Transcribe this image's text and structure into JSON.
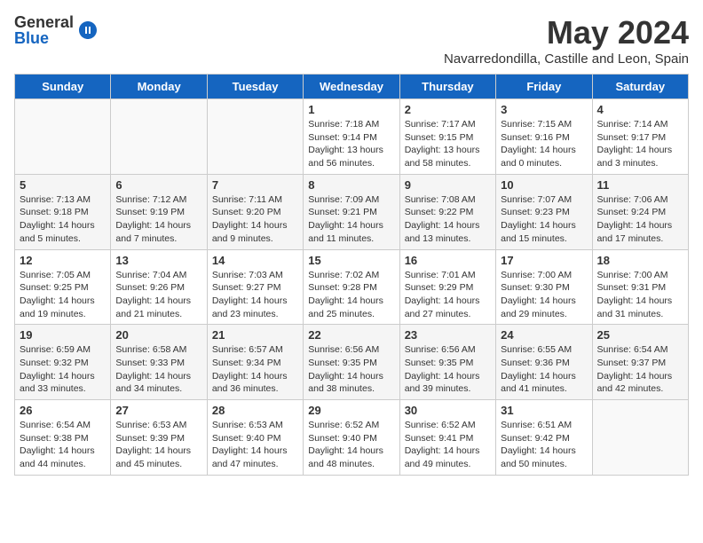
{
  "logo": {
    "general": "General",
    "blue": "Blue"
  },
  "header": {
    "month": "May 2024",
    "location": "Navarredondilla, Castille and Leon, Spain"
  },
  "days_of_week": [
    "Sunday",
    "Monday",
    "Tuesday",
    "Wednesday",
    "Thursday",
    "Friday",
    "Saturday"
  ],
  "weeks": [
    [
      {
        "day": "",
        "info": ""
      },
      {
        "day": "",
        "info": ""
      },
      {
        "day": "",
        "info": ""
      },
      {
        "day": "1",
        "info": "Sunrise: 7:18 AM\nSunset: 9:14 PM\nDaylight: 13 hours\nand 56 minutes."
      },
      {
        "day": "2",
        "info": "Sunrise: 7:17 AM\nSunset: 9:15 PM\nDaylight: 13 hours\nand 58 minutes."
      },
      {
        "day": "3",
        "info": "Sunrise: 7:15 AM\nSunset: 9:16 PM\nDaylight: 14 hours\nand 0 minutes."
      },
      {
        "day": "4",
        "info": "Sunrise: 7:14 AM\nSunset: 9:17 PM\nDaylight: 14 hours\nand 3 minutes."
      }
    ],
    [
      {
        "day": "5",
        "info": "Sunrise: 7:13 AM\nSunset: 9:18 PM\nDaylight: 14 hours\nand 5 minutes."
      },
      {
        "day": "6",
        "info": "Sunrise: 7:12 AM\nSunset: 9:19 PM\nDaylight: 14 hours\nand 7 minutes."
      },
      {
        "day": "7",
        "info": "Sunrise: 7:11 AM\nSunset: 9:20 PM\nDaylight: 14 hours\nand 9 minutes."
      },
      {
        "day": "8",
        "info": "Sunrise: 7:09 AM\nSunset: 9:21 PM\nDaylight: 14 hours\nand 11 minutes."
      },
      {
        "day": "9",
        "info": "Sunrise: 7:08 AM\nSunset: 9:22 PM\nDaylight: 14 hours\nand 13 minutes."
      },
      {
        "day": "10",
        "info": "Sunrise: 7:07 AM\nSunset: 9:23 PM\nDaylight: 14 hours\nand 15 minutes."
      },
      {
        "day": "11",
        "info": "Sunrise: 7:06 AM\nSunset: 9:24 PM\nDaylight: 14 hours\nand 17 minutes."
      }
    ],
    [
      {
        "day": "12",
        "info": "Sunrise: 7:05 AM\nSunset: 9:25 PM\nDaylight: 14 hours\nand 19 minutes."
      },
      {
        "day": "13",
        "info": "Sunrise: 7:04 AM\nSunset: 9:26 PM\nDaylight: 14 hours\nand 21 minutes."
      },
      {
        "day": "14",
        "info": "Sunrise: 7:03 AM\nSunset: 9:27 PM\nDaylight: 14 hours\nand 23 minutes."
      },
      {
        "day": "15",
        "info": "Sunrise: 7:02 AM\nSunset: 9:28 PM\nDaylight: 14 hours\nand 25 minutes."
      },
      {
        "day": "16",
        "info": "Sunrise: 7:01 AM\nSunset: 9:29 PM\nDaylight: 14 hours\nand 27 minutes."
      },
      {
        "day": "17",
        "info": "Sunrise: 7:00 AM\nSunset: 9:30 PM\nDaylight: 14 hours\nand 29 minutes."
      },
      {
        "day": "18",
        "info": "Sunrise: 7:00 AM\nSunset: 9:31 PM\nDaylight: 14 hours\nand 31 minutes."
      }
    ],
    [
      {
        "day": "19",
        "info": "Sunrise: 6:59 AM\nSunset: 9:32 PM\nDaylight: 14 hours\nand 33 minutes."
      },
      {
        "day": "20",
        "info": "Sunrise: 6:58 AM\nSunset: 9:33 PM\nDaylight: 14 hours\nand 34 minutes."
      },
      {
        "day": "21",
        "info": "Sunrise: 6:57 AM\nSunset: 9:34 PM\nDaylight: 14 hours\nand 36 minutes."
      },
      {
        "day": "22",
        "info": "Sunrise: 6:56 AM\nSunset: 9:35 PM\nDaylight: 14 hours\nand 38 minutes."
      },
      {
        "day": "23",
        "info": "Sunrise: 6:56 AM\nSunset: 9:35 PM\nDaylight: 14 hours\nand 39 minutes."
      },
      {
        "day": "24",
        "info": "Sunrise: 6:55 AM\nSunset: 9:36 PM\nDaylight: 14 hours\nand 41 minutes."
      },
      {
        "day": "25",
        "info": "Sunrise: 6:54 AM\nSunset: 9:37 PM\nDaylight: 14 hours\nand 42 minutes."
      }
    ],
    [
      {
        "day": "26",
        "info": "Sunrise: 6:54 AM\nSunset: 9:38 PM\nDaylight: 14 hours\nand 44 minutes."
      },
      {
        "day": "27",
        "info": "Sunrise: 6:53 AM\nSunset: 9:39 PM\nDaylight: 14 hours\nand 45 minutes."
      },
      {
        "day": "28",
        "info": "Sunrise: 6:53 AM\nSunset: 9:40 PM\nDaylight: 14 hours\nand 47 minutes."
      },
      {
        "day": "29",
        "info": "Sunrise: 6:52 AM\nSunset: 9:40 PM\nDaylight: 14 hours\nand 48 minutes."
      },
      {
        "day": "30",
        "info": "Sunrise: 6:52 AM\nSunset: 9:41 PM\nDaylight: 14 hours\nand 49 minutes."
      },
      {
        "day": "31",
        "info": "Sunrise: 6:51 AM\nSunset: 9:42 PM\nDaylight: 14 hours\nand 50 minutes."
      },
      {
        "day": "",
        "info": ""
      }
    ]
  ]
}
